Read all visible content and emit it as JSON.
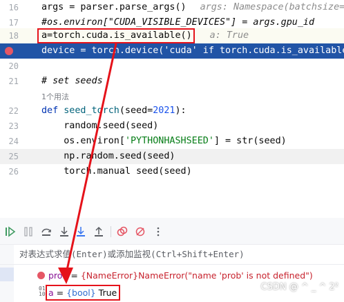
{
  "editor": {
    "lines": [
      {
        "num": "16",
        "code": "args = parser.parse_args()",
        "hint": "args: Namespace(batchsize=..."
      },
      {
        "num": "17",
        "code": "#os.environ[\"CUDA_VISIBLE_DEVICES\"] = args.gpu_id"
      },
      {
        "num": "18",
        "code": "a=torch.cuda.is_available()",
        "hint": "a: True"
      },
      {
        "num": "19",
        "code": "device = torch.device('cuda' if torch.cuda.is_available"
      },
      {
        "num": "20",
        "code": ""
      },
      {
        "num": "21",
        "code": "# set seeds"
      },
      {
        "num": "22",
        "code": "def seed_torch(seed=2021):"
      },
      {
        "num": "23",
        "code": "    random.seed(seed)"
      },
      {
        "num": "24",
        "code": "    os.environ['PYTHONHASHSEED'] = str(seed)"
      },
      {
        "num": "25",
        "code": "    np.random.seed(seed)"
      },
      {
        "num": "26",
        "code": "    torch.manual_seed(seed)"
      }
    ],
    "usage_hint": "1个用法"
  },
  "debugger": {
    "eval_placeholder": "对表达式求值(Enter)或添加监视(Ctrl+Shift+Enter)",
    "variables": [
      {
        "name": "prob",
        "eq": " = ",
        "value": "{NameError}NameError(\"name 'prob' is not defined\")"
      },
      {
        "name": "a",
        "eq": " = ",
        "type": "{bool}",
        "value": " True"
      }
    ]
  },
  "watermark": "CSDN @ ^ _ ^ 2²",
  "colors": {
    "exec_line": "#2154a6",
    "breakpoint": "#e55765",
    "annotation_red": "#e5121a",
    "keyword": "#0033b3",
    "string": "#067d17",
    "number": "#1750eb"
  }
}
